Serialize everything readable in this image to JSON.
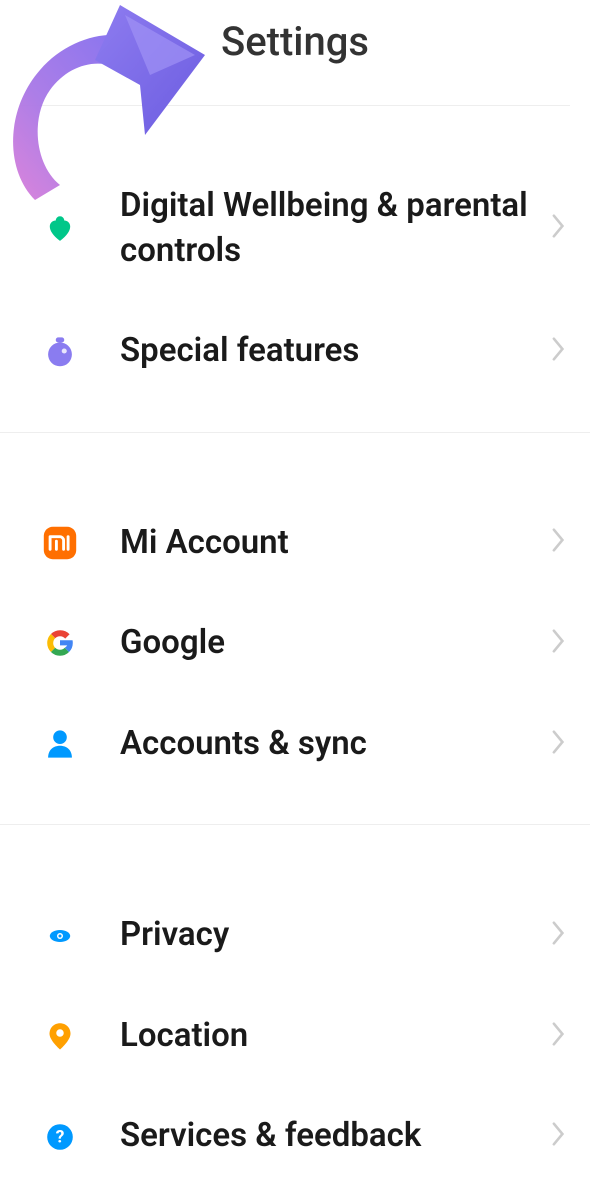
{
  "header": {
    "title": "Settings"
  },
  "items": [
    {
      "icon": "wellbeing-heart-icon",
      "label": "Digital Wellbeing & parental controls"
    },
    {
      "icon": "flask-icon",
      "label": "Special features"
    },
    {
      "icon": "mi-logo-icon",
      "label": "Mi Account"
    },
    {
      "icon": "google-logo-icon",
      "label": "Google"
    },
    {
      "icon": "person-icon",
      "label": "Accounts & sync"
    },
    {
      "icon": "eye-icon",
      "label": "Privacy"
    },
    {
      "icon": "location-pin-icon",
      "label": "Location"
    },
    {
      "icon": "help-icon",
      "label": "Services & feedback"
    }
  ]
}
